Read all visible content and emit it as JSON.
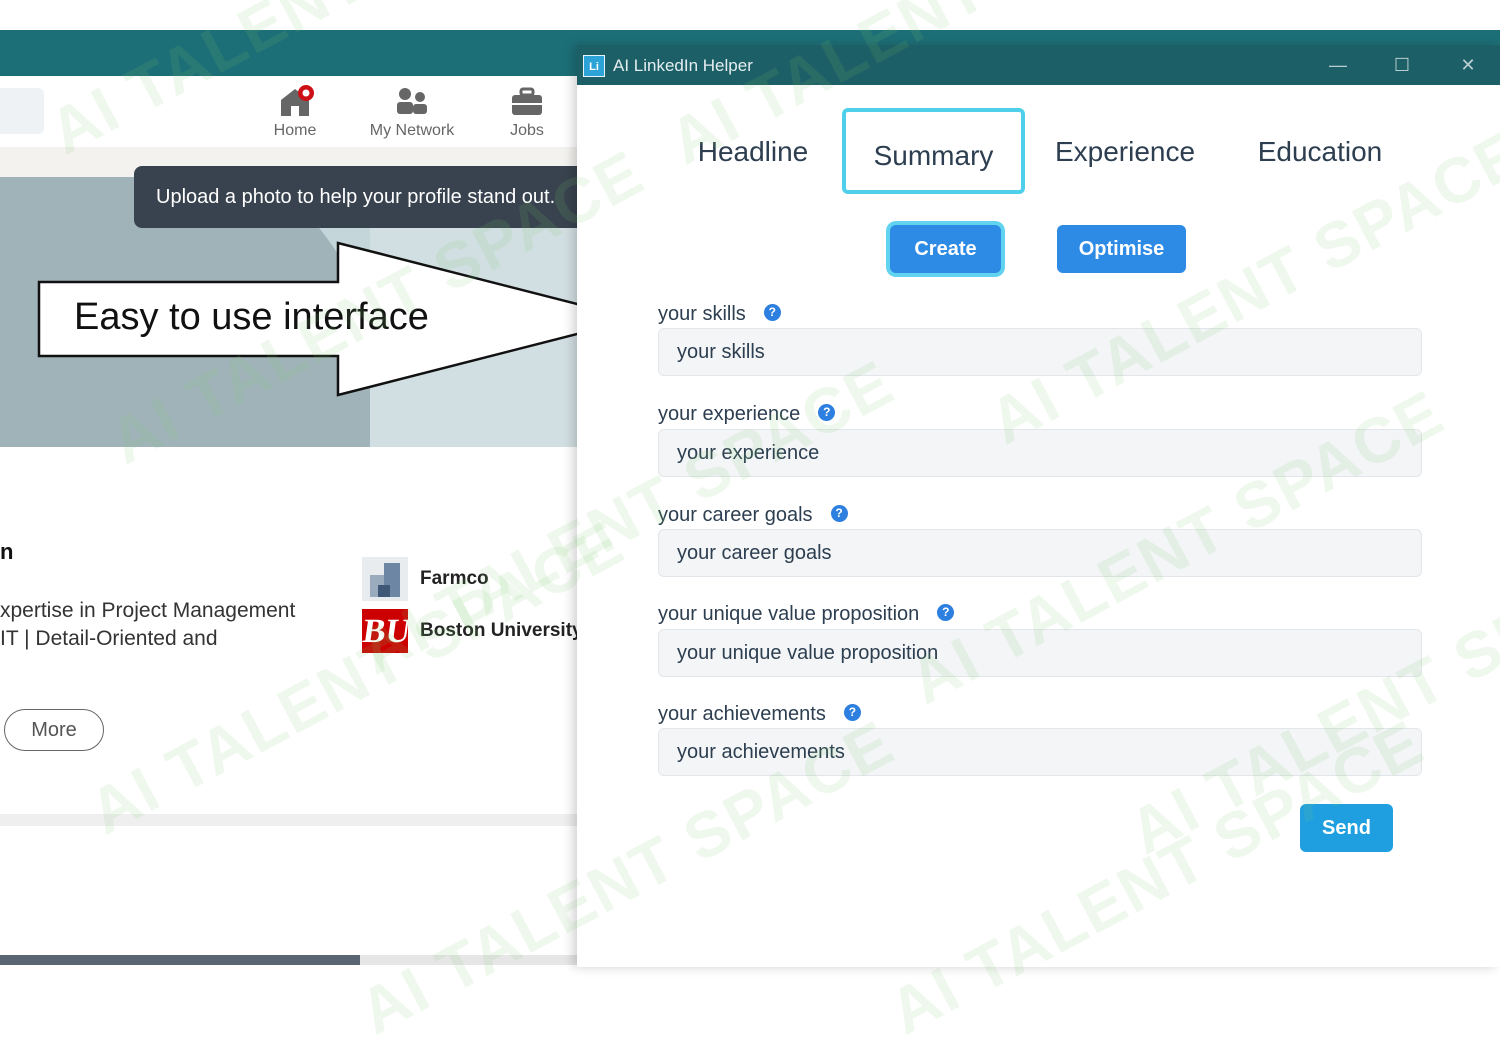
{
  "linkedin": {
    "nav": [
      {
        "label": "Home",
        "icon": "home-icon"
      },
      {
        "label": "My Network",
        "icon": "people-icon"
      },
      {
        "label": "Jobs",
        "icon": "briefcase-icon"
      }
    ],
    "tooltip": "Upload a photo to help your profile stand out.",
    "profile": {
      "name_fragment": "n",
      "headline_line1": "xpertise in Project Management",
      "headline_line2": "IT | Detail-Oriented and",
      "experience": "Farmco",
      "education": "Boston University",
      "education_logo_text": "BU",
      "more_button": "More"
    }
  },
  "callout": {
    "text": "Easy to use interface"
  },
  "app": {
    "title": "AI LinkedIn Helper",
    "icon_text": "Li",
    "window_controls": [
      "—",
      "☐",
      "✕"
    ],
    "tabs": [
      "Headline",
      "Summary",
      "Experience",
      "Education"
    ],
    "active_tab": "Summary",
    "actions": {
      "create": "Create",
      "optimise": "Optimise"
    },
    "fields": [
      {
        "label": "your skills",
        "placeholder": "your skills"
      },
      {
        "label": "your experience",
        "placeholder": "your experience"
      },
      {
        "label": "your career goals",
        "placeholder": "your career goals"
      },
      {
        "label": "your unique value proposition",
        "placeholder": "your unique value proposition"
      },
      {
        "label": "your achievements",
        "placeholder": "your achievements"
      }
    ],
    "help_icon": "?",
    "send": "Send"
  },
  "watermark": "AI TALENT SPACE",
  "colors": {
    "accent": "#2d8ae5",
    "titlebar": "#1d5f66",
    "active_tab_border": "#4fd0ea",
    "send": "#1f9fe0"
  }
}
